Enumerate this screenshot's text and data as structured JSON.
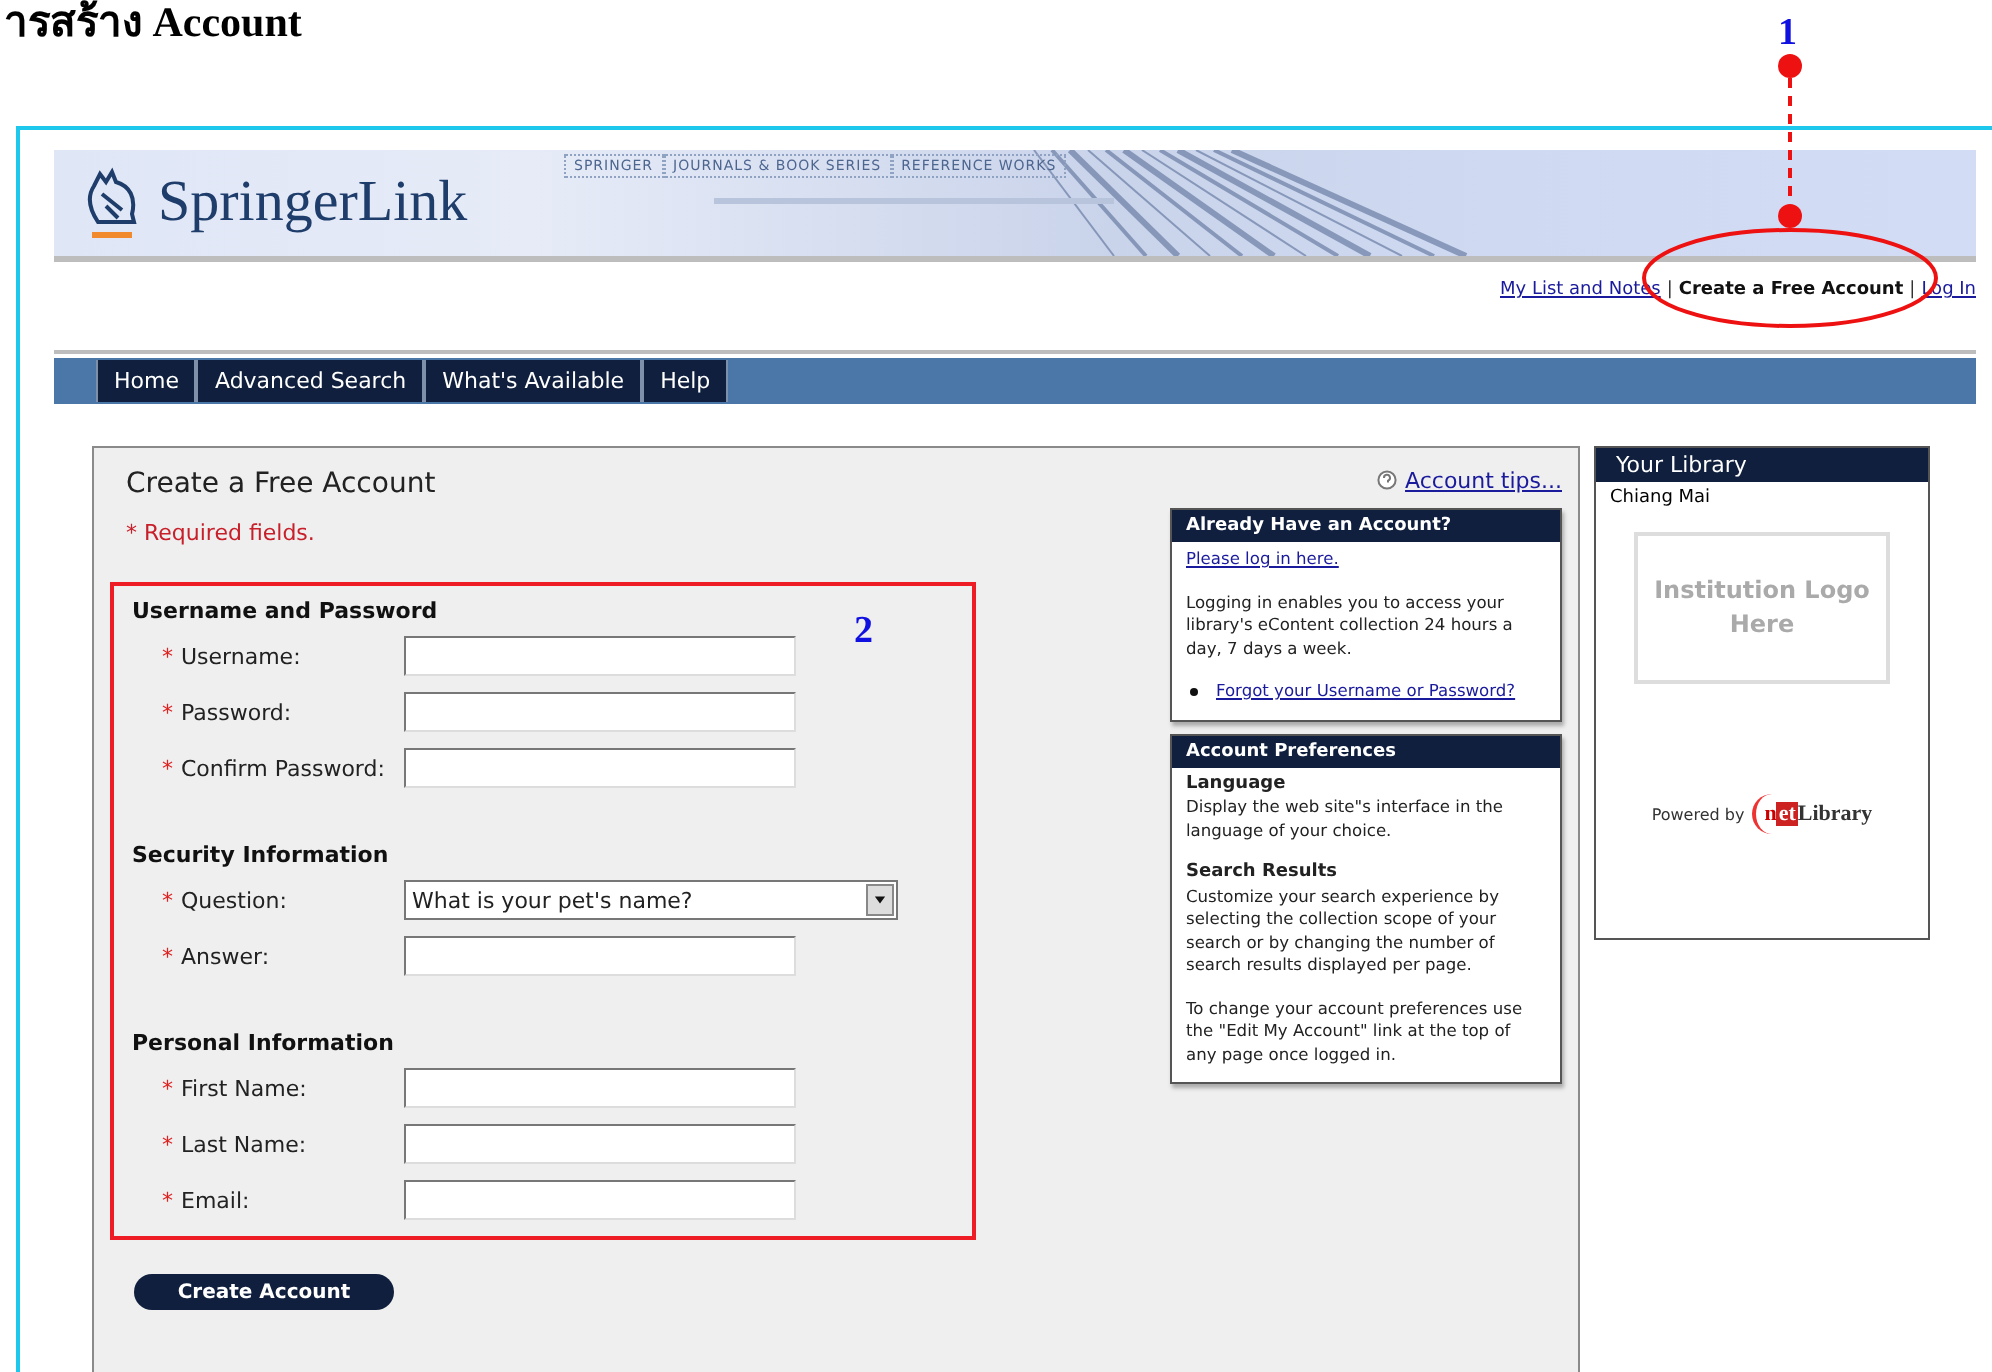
{
  "heading": "ารสร้าง Account",
  "annotations": [
    {
      "number": "1"
    },
    {
      "number": "2"
    }
  ],
  "banner": {
    "logo": "SpringerLink",
    "tabs": [
      "SPRINGER",
      "JOURNALS & BOOK SERIES",
      "REFERENCE WORKS"
    ]
  },
  "top_links": [
    {
      "label": "My List and Notes",
      "kind": "link"
    },
    {
      "label": "|",
      "kind": "separator"
    },
    {
      "label": "Create a Free Account",
      "kind": "current"
    },
    {
      "label": "|",
      "kind": "separator"
    },
    {
      "label": "Log In",
      "kind": "link"
    }
  ],
  "nav": [
    "Home",
    "Advanced Search",
    "What's Available",
    "Help"
  ],
  "form": {
    "title": "Create a Free Account",
    "required_note": "* Required fields.",
    "tips_link": "Account tips...",
    "sections": [
      {
        "title": "Username and Password",
        "fields": [
          {
            "mark": "*",
            "label": "Username:",
            "kind": "text"
          },
          {
            "mark": "*",
            "label": "Password:",
            "kind": "text"
          },
          {
            "mark": "*",
            "label": "Confirm Password:",
            "kind": "text"
          }
        ]
      },
      {
        "title": "Security Information",
        "fields": [
          {
            "mark": "*",
            "label": "Question:",
            "kind": "select",
            "value": "What is your pet's name?"
          },
          {
            "mark": "*",
            "label": "Answer:",
            "kind": "text"
          }
        ]
      },
      {
        "title": "Personal Information",
        "fields": [
          {
            "mark": "*",
            "label": "First Name:",
            "kind": "text"
          },
          {
            "mark": "*",
            "label": "Last Name:",
            "kind": "text"
          },
          {
            "mark": "*",
            "label": "Email:",
            "kind": "text"
          }
        ]
      }
    ],
    "submit": "Create Account"
  },
  "login_box": {
    "title": "Already Have an Account?",
    "link": "Please log in here.",
    "text": "Logging in enables you to access your library's eContent collection 24 hours a day, 7 days a week.",
    "bullet_link": "Forgot your Username or Password?"
  },
  "preferences_box": {
    "title": "Account Preferences",
    "items": [
      {
        "title": "Language",
        "text": "Display the web site\"s interface in the language of your choice."
      },
      {
        "title": "Search Results",
        "text": "Customize your search experience by selecting the collection scope of your search or by changing the number of search results displayed per page."
      }
    ],
    "note": "To change your account preferences use the \"Edit My Account\" link at the top of any page once logged in."
  },
  "library": {
    "title": "Your Library",
    "name": "Chiang Mai",
    "logo_placeholder": "Institution Logo Here",
    "powered_by": "Powered by",
    "brand": [
      "n",
      "et",
      "Library"
    ]
  }
}
